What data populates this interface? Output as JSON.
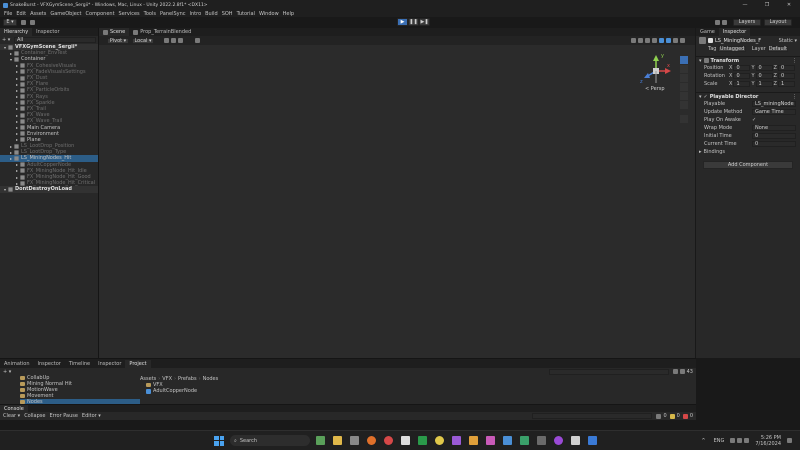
{
  "titlebar": {
    "title": "SnakeBurst - VFXGymScene_Sergii* - Windows, Mac, Linux - Unity 2022.2.8f1* <DX11>",
    "min": "—",
    "max": "❐",
    "close": "✕"
  },
  "menu": [
    "File",
    "Edit",
    "Assets",
    "GameObject",
    "Component",
    "Services",
    "Tools",
    "PanelSync",
    "Intro",
    "Build",
    "SOH",
    "Tutorial",
    "Window",
    "Help"
  ],
  "toolbar": {
    "account": "E ▾",
    "play": "▶",
    "pause": "❚❚",
    "step": "▶❚",
    "layers": "Layers",
    "layout": "Layout"
  },
  "hierarchy": {
    "tabs": [
      "Hierarchy",
      "Inspector"
    ],
    "add": "+ ▾",
    "search": "All",
    "items": [
      {
        "label": "VFXGymScene_Sergii*",
        "indent": 0,
        "style": "scene"
      },
      {
        "label": "Container_EnvTest",
        "indent": 1,
        "style": "dim"
      },
      {
        "label": "Container",
        "indent": 1,
        "style": "normal"
      },
      {
        "label": "FX_CohesiveVisuals",
        "indent": 2,
        "style": "dim"
      },
      {
        "label": "FX_FadeVisualsSettings",
        "indent": 2,
        "style": "dim"
      },
      {
        "label": "FX_Dust",
        "indent": 2,
        "style": "dim"
      },
      {
        "label": "FX_Flare",
        "indent": 2,
        "style": "dim"
      },
      {
        "label": "FX_ParticleOrbits",
        "indent": 2,
        "style": "dim"
      },
      {
        "label": "FX_Rays",
        "indent": 2,
        "style": "dim"
      },
      {
        "label": "FX_Sparkle",
        "indent": 2,
        "style": "dim"
      },
      {
        "label": "FX_Trail",
        "indent": 2,
        "style": "dim"
      },
      {
        "label": "FX_Wave",
        "indent": 2,
        "style": "dim"
      },
      {
        "label": "FX_Wave_Trail",
        "indent": 2,
        "style": "dim"
      },
      {
        "label": "Main Camera",
        "indent": 2,
        "style": "normal"
      },
      {
        "label": "Environment",
        "indent": 2,
        "style": "normal"
      },
      {
        "label": "Plane",
        "indent": 2,
        "style": "normal"
      },
      {
        "label": "LS_LootDrop_Position",
        "indent": 1,
        "style": "dim"
      },
      {
        "label": "LS_LootDrop_Type",
        "indent": 1,
        "style": "dim"
      },
      {
        "label": "LS_MiningNodes_Hit",
        "indent": 1,
        "style": "selected"
      },
      {
        "label": "AdultCopperNode",
        "indent": 2,
        "style": "dim"
      },
      {
        "label": "FX_MiningNode_Hit_Idle",
        "indent": 2,
        "style": "dim"
      },
      {
        "label": "FX_MiningNode_Hit_Good",
        "indent": 2,
        "style": "dim"
      },
      {
        "label": "FX_MiningNode_Hit_Critical",
        "indent": 2,
        "style": "dim"
      },
      {
        "label": "DontDestroyOnLoad",
        "indent": 0,
        "style": "scene"
      }
    ]
  },
  "scene": {
    "tabs": [
      "Scene",
      "Prop_TerrainBlended"
    ],
    "pivot": "Pivot ▾",
    "local": "Local ▾",
    "persp": "< Persp",
    "gizmo_y": "y",
    "gizmo_x": "x",
    "gizmo_z": "z"
  },
  "inspector": {
    "tabs": [
      "Game",
      "Inspector"
    ],
    "object_name": "LS_MiningNodes_F",
    "static": "Static ▾",
    "tag_label": "Tag",
    "tag_value": "Untagged",
    "layer_label": "Layer",
    "layer_value": "Default",
    "transform": {
      "title": "Transform",
      "rows": [
        {
          "label": "Position",
          "x": "0",
          "y": "0",
          "z": "0"
        },
        {
          "label": "Rotation",
          "x": "0",
          "y": "0",
          "z": "0"
        },
        {
          "label": "Scale",
          "x": "1",
          "y": "1",
          "z": "1"
        }
      ]
    },
    "director": {
      "title": "Playable Director",
      "fields": [
        {
          "label": "Playable",
          "value": "LS_miningNode"
        },
        {
          "label": "Update Method",
          "value": "Game Time"
        },
        {
          "label": "Play On Awake",
          "value": "✓"
        },
        {
          "label": "Wrap Mode",
          "value": "None"
        },
        {
          "label": "Initial Time",
          "value": "0"
        },
        {
          "label": "Current Time",
          "value": "0"
        }
      ],
      "bindings": "Bindings"
    },
    "add_component": "Add Component"
  },
  "bottom": {
    "tabs": [
      "Animation",
      "Inspector",
      "Timeline",
      "Inspector",
      "Project"
    ],
    "breadcrumb": [
      "Assets",
      "VFX",
      "Prefabs",
      "Nodes"
    ],
    "tree": [
      "CollabUp",
      "Mining Normal Hit",
      "MotionWave",
      "Movement",
      "Nodes"
    ],
    "files": [
      "VFX",
      "AdultCopperNode"
    ],
    "count": "43"
  },
  "console": {
    "tab": "Console",
    "buttons": [
      "Clear ▾",
      "Collapse",
      "Error Pause",
      "Editor ▾"
    ],
    "counts": [
      "0",
      "0",
      "0"
    ]
  },
  "taskbar": {
    "search": "Search",
    "lang": "ENG",
    "time": "5:26 PM",
    "date": "7/16/2024"
  }
}
